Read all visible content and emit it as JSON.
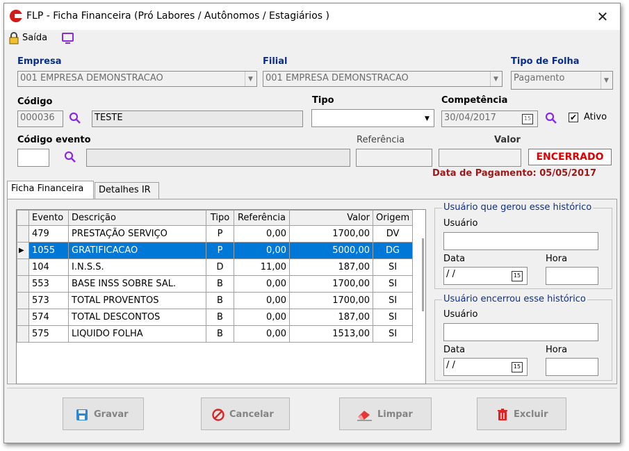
{
  "window": {
    "title": "FLP - Ficha Financeira (Pró Labores / Autônomos / Estagiários )",
    "close": "✕"
  },
  "toolbar": {
    "exit_label": "Saída"
  },
  "labels": {
    "empresa": "Empresa",
    "filial": "Filial",
    "tipo_folha": "Tipo de Folha",
    "codigo": "Código",
    "tipo": "Tipo",
    "competencia": "Competência",
    "ativo": "Ativo",
    "codigo_evento": "Código evento",
    "referencia": "Referência",
    "valor": "Valor"
  },
  "fields": {
    "empresa": "001 EMPRESA DEMONSTRACAO",
    "filial": "001 EMPRESA DEMONSTRACAO",
    "tipo_folha": "Pagamento",
    "codigo": "000036",
    "nome": "TESTE",
    "tipo": "",
    "competencia": "30/04/2017",
    "ativo_checked": true,
    "codigo_evento": "",
    "evento_desc": "",
    "referencia": "",
    "valor": ""
  },
  "status": {
    "encerrado": "ENCERRADO",
    "data_pagamento": "Data de Pagamento: 05/05/2017"
  },
  "tabs": [
    {
      "label": "Ficha Financeira"
    },
    {
      "label": "Detalhes IR"
    }
  ],
  "table": {
    "headers": [
      "Evento",
      "Descrição",
      "Tipo",
      "Referência",
      "Valor",
      "Origem"
    ],
    "selected_row": 1,
    "rows": [
      [
        "479",
        "PRESTAÇÃO SERVIÇO",
        "P",
        "0,00",
        "1700,00",
        "DV"
      ],
      [
        "1055",
        "GRATIFICACAO",
        "P",
        "0,00",
        "5000,00",
        "DG"
      ],
      [
        "104",
        "I.N.S.S.",
        "D",
        "11,00",
        "187,00",
        "SI"
      ],
      [
        "553",
        "BASE INSS SOBRE SAL.",
        "B",
        "0,00",
        "1700,00",
        "SI"
      ],
      [
        "573",
        "TOTAL PROVENTOS",
        "B",
        "0,00",
        "1700,00",
        "SI"
      ],
      [
        "574",
        "TOTAL DESCONTOS",
        "B",
        "0,00",
        "187,00",
        "SI"
      ],
      [
        "575",
        "LIQUIDO FOLHA",
        "B",
        "0,00",
        "1513,00",
        "SI"
      ]
    ]
  },
  "group_gerou": {
    "title": "Usuário que gerou esse histórico",
    "usuario_label": "Usuário",
    "data_label": "Data",
    "hora_label": "Hora",
    "data_value": "/ /",
    "usuario_value": "",
    "hora_value": ""
  },
  "group_encerrou": {
    "title": "Usuário encerrou esse histórico",
    "usuario_label": "Usuário",
    "data_label": "Data",
    "hora_label": "Hora",
    "data_value": "/ /",
    "usuario_value": "",
    "hora_value": ""
  },
  "calendar_glyph": "15",
  "buttons": {
    "gravar": "Gravar",
    "cancelar": "Cancelar",
    "limpar": "Limpar",
    "excluir": "Excluir"
  },
  "colors": {
    "accent_blue": "#0a2e8c",
    "selection": "#0078d7",
    "encerrado_red": "#e00000",
    "data_pag_red": "#a01818",
    "search_icon": "#8a2be2"
  }
}
